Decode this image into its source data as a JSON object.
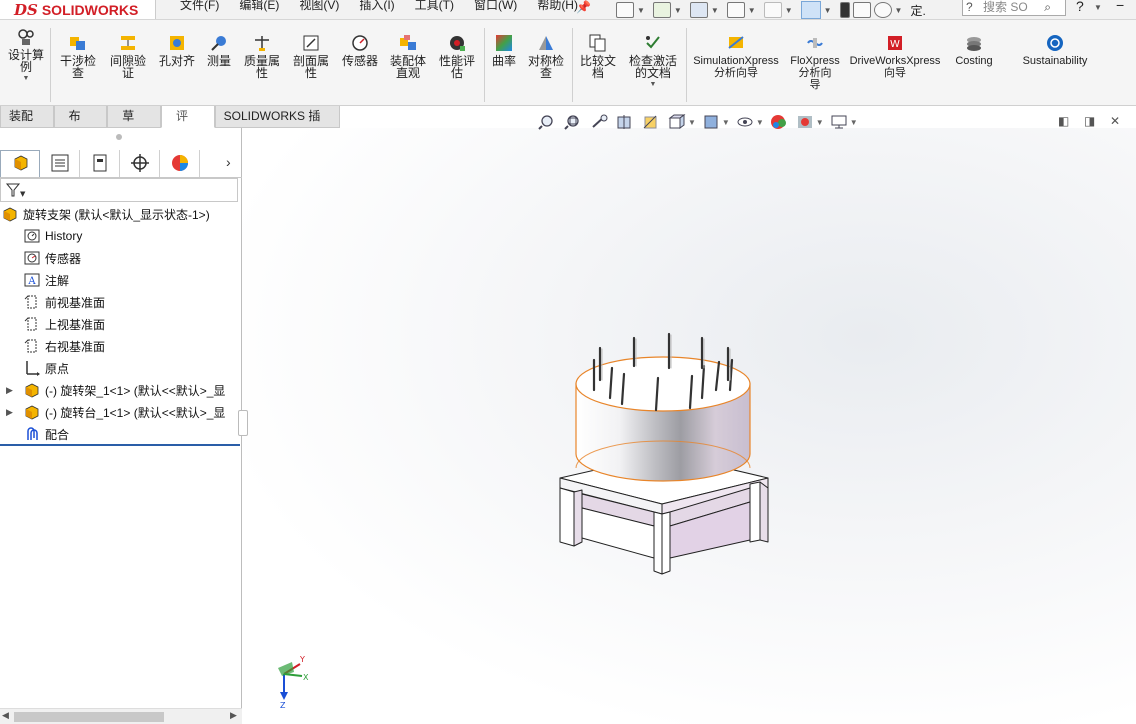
{
  "app": {
    "logo_ds": "DS",
    "logo_text": "SOLIDWORKS",
    "brand_color": "#d21e26"
  },
  "menu": [
    "文件(F)",
    "编辑(E)",
    "视图(V)",
    "插入(I)",
    "工具(T)",
    "窗口(W)",
    "帮助(H)"
  ],
  "search": {
    "placeholder": "搜索 SO"
  },
  "quick_access": {
    "truncated_label": "定."
  },
  "toolbar": {
    "groups": [
      {
        "label": "设计算\n例",
        "icon": "design-study-icon"
      },
      {
        "label": "干涉检\n查",
        "icon": "interference-icon"
      },
      {
        "label": "间隙验\n证",
        "icon": "clearance-icon"
      },
      {
        "label": "孔对齐",
        "icon": "hole-alignment-icon"
      },
      {
        "label": "测量",
        "icon": "measure-icon"
      },
      {
        "label": "质量属\n性",
        "icon": "mass-properties-icon"
      },
      {
        "label": "剖面属\n性",
        "icon": "section-properties-icon"
      },
      {
        "label": "传感器",
        "icon": "sensor-icon"
      },
      {
        "label": "装配体\n直观",
        "icon": "assembly-visualization-icon"
      },
      {
        "label": "性能评\n估",
        "icon": "performance-icon"
      },
      {
        "label": "曲率",
        "icon": "curvature-icon"
      },
      {
        "label": "对称检\n查",
        "icon": "symmetry-icon"
      },
      {
        "label": "比较文\n档",
        "icon": "compare-icon"
      },
      {
        "label": "检查激活\n的文档",
        "icon": "check-document-icon"
      },
      {
        "label": "SimulationXpress\n分析向导",
        "icon": "simulationxpress-icon"
      },
      {
        "label": "FloXpress\n分析向\n导",
        "icon": "floxpress-icon"
      },
      {
        "label": "DriveWorksXpress\n向导",
        "icon": "driveworksxpress-icon"
      },
      {
        "label": "Costing",
        "icon": "costing-icon"
      },
      {
        "label": "Sustainability",
        "icon": "sustainability-icon"
      }
    ]
  },
  "tabs": [
    {
      "label": "装配体",
      "active": false
    },
    {
      "label": "布局",
      "active": false
    },
    {
      "label": "草图",
      "active": false
    },
    {
      "label": "评估",
      "active": true
    },
    {
      "label": "SOLIDWORKS 插件",
      "active": false
    }
  ],
  "tree": {
    "root": "旋转支架  (默认<默认_显示状态-1>)",
    "items": [
      {
        "label": "History",
        "icon": "history-icon"
      },
      {
        "label": "传感器",
        "icon": "sensor-folder-icon"
      },
      {
        "label": "注解",
        "icon": "annotation-icon"
      },
      {
        "label": "前视基准面",
        "icon": "plane-icon"
      },
      {
        "label": "上视基准面",
        "icon": "plane-icon"
      },
      {
        "label": "右视基准面",
        "icon": "plane-icon"
      },
      {
        "label": "原点",
        "icon": "origin-icon"
      },
      {
        "label": "(-) 旋转架_1<1> (默认<<默认>_显",
        "icon": "part-icon",
        "expandable": true
      },
      {
        "label": "(-) 旋转台_1<1> (默认<<默认>_显",
        "icon": "part-icon",
        "expandable": true
      },
      {
        "label": "配合",
        "icon": "mates-icon"
      }
    ]
  },
  "triad": {
    "x": "X",
    "y": "Y",
    "z": "Z"
  }
}
